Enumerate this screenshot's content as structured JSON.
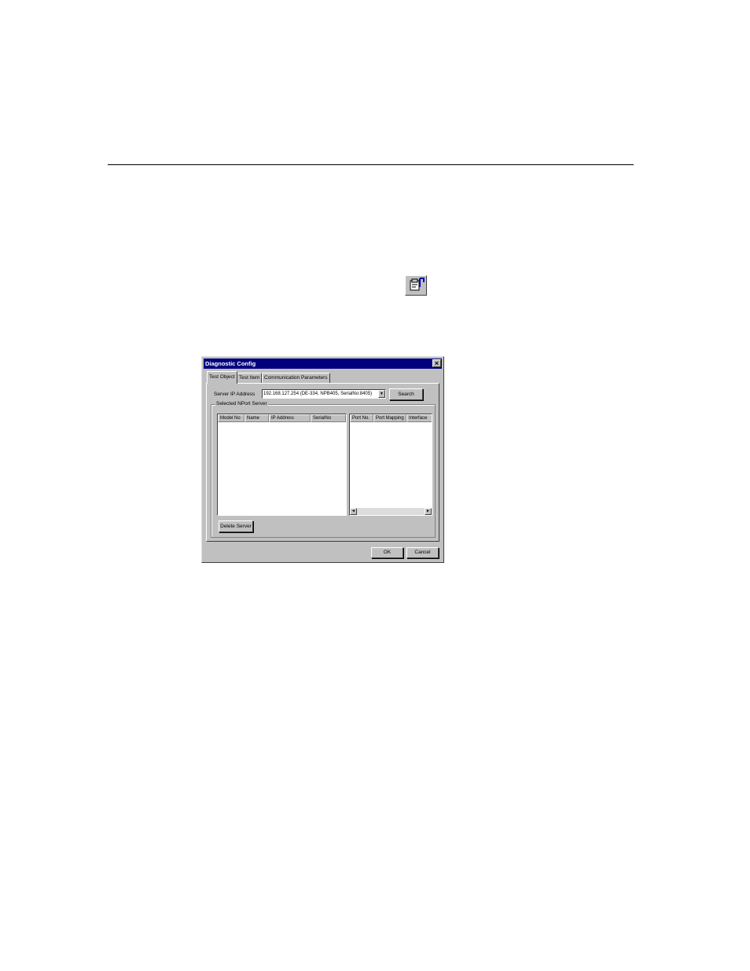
{
  "dialog": {
    "title": "Diagnostic Config",
    "close_glyph": "×",
    "tabs": [
      {
        "label": "Test Object",
        "active": true
      },
      {
        "label": "Test Item",
        "active": false
      },
      {
        "label": "Communication Parameters",
        "active": false
      }
    ],
    "server_ip": {
      "label": "Server IP Address",
      "value": "192.168.127.254 (DE-334, NPB405, SerialNo:8405)",
      "dropdown_glyph": "▼"
    },
    "search_label": "Search",
    "group_label": "Selected NPort Server",
    "server_list": {
      "columns": [
        "Model No",
        "Name",
        "IP Address",
        "SerialNo"
      ],
      "rows": []
    },
    "port_list": {
      "columns": [
        "Port No.",
        "Port Mapping",
        "Interface"
      ],
      "rows": []
    },
    "scroll_left_glyph": "◄",
    "scroll_right_glyph": "►",
    "delete_server_label": "Delete Server",
    "ok_label": "OK",
    "cancel_label": "Cancel"
  },
  "toolbar_icon": "diagnostic-config-icon"
}
